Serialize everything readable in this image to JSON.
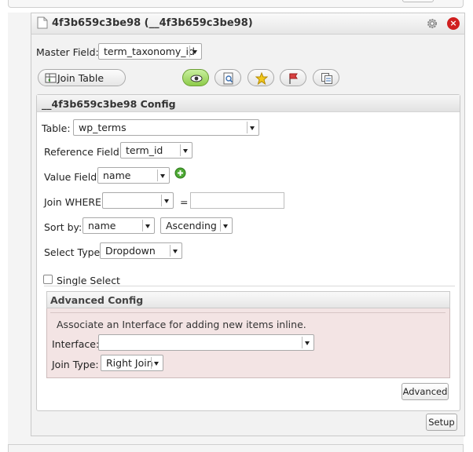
{
  "panel": {
    "title": "4f3b659c3be98 (__4f3b659c3be98)",
    "master_field_label": "Master Field:",
    "master_field_value": "term_taxonomy_id",
    "join_table_label": "Join Table"
  },
  "toolbar_icons": [
    "eye-icon",
    "zoom-page-icon",
    "star-icon",
    "flag-icon",
    "copy-icon"
  ],
  "config": {
    "title": "__4f3b659c3be98 Config",
    "table_label": "Table:",
    "table_value": "wp_terms",
    "reference_field_label": "Reference Field:",
    "reference_field_value": "term_id",
    "value_field_label": "Value Field:",
    "value_field_value": "name",
    "join_where_label": "Join WHERE:",
    "join_where_value": "",
    "equals": "=",
    "join_where_input": "",
    "sort_by_label": "Sort by:",
    "sort_by_value": "name",
    "sort_order_value": "Ascending",
    "select_type_label": "Select Type:",
    "select_type_value": "Dropdown",
    "single_select_label": "Single Select"
  },
  "advanced": {
    "title": "Advanced Config",
    "note": "Associate an Interface for adding new items inline.",
    "interface_label": "Interface:",
    "interface_value": "",
    "join_type_label": "Join Type:",
    "join_type_value": "Right Join",
    "advanced_button": "Advanced"
  },
  "setup_button": "Setup",
  "colors": {
    "active_green": "#8ecb4a",
    "close_red": "#d01f1f",
    "advanced_bg": "#f3e4e4"
  }
}
